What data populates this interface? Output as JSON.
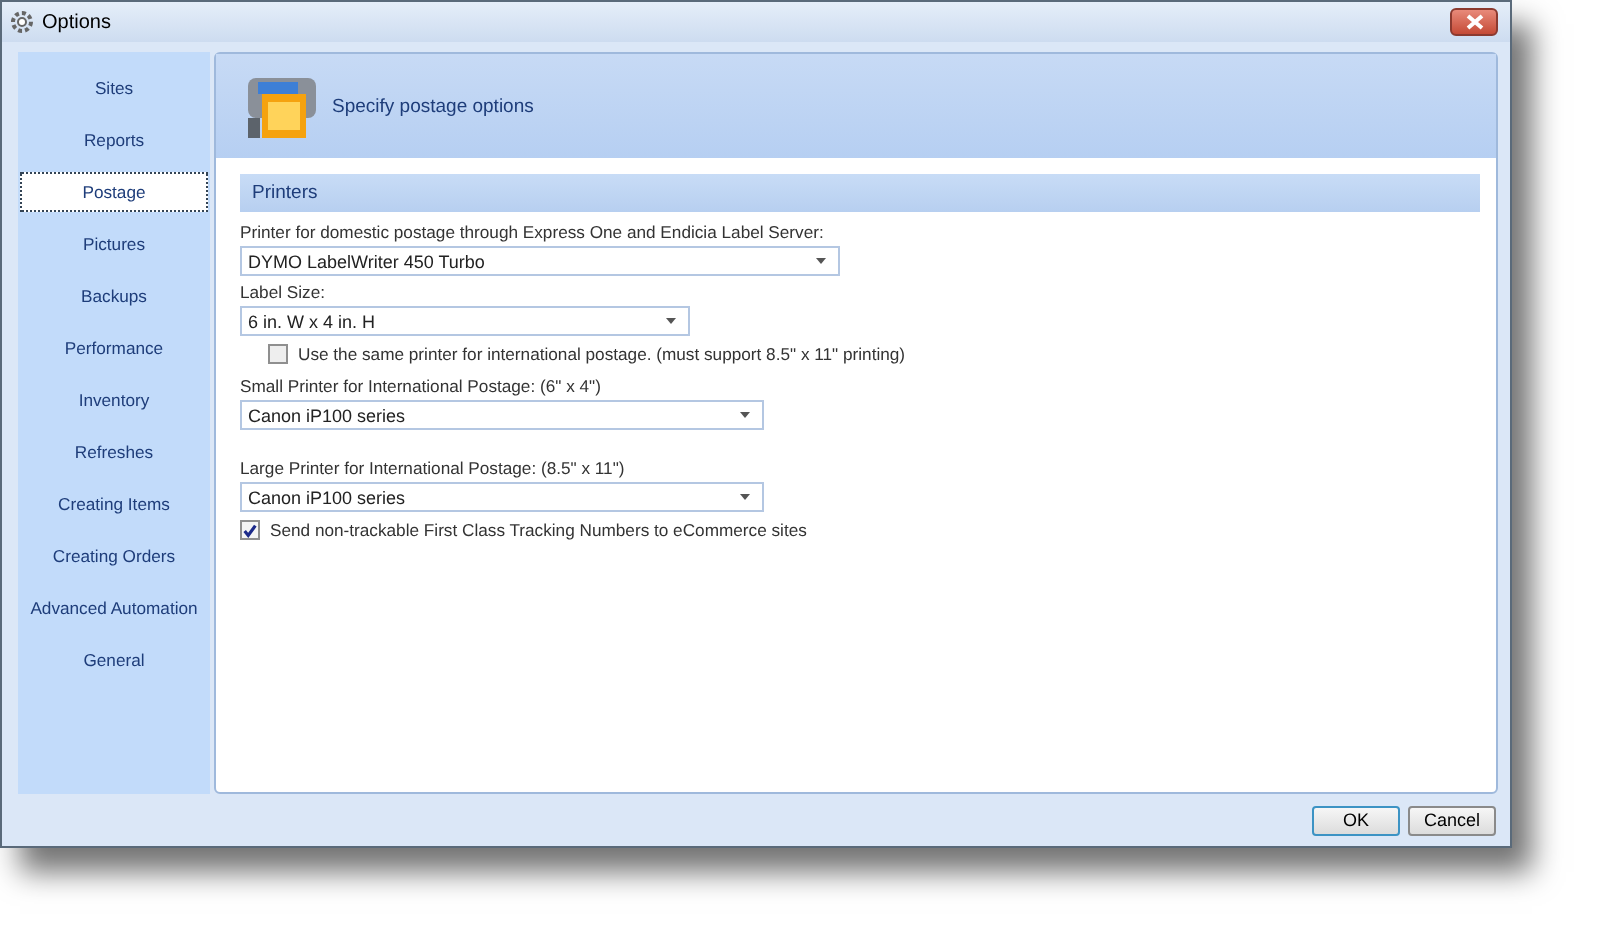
{
  "window": {
    "title": "Options"
  },
  "sidebar": {
    "items": [
      {
        "label": "Sites",
        "selected": false
      },
      {
        "label": "Reports",
        "selected": false
      },
      {
        "label": "Postage",
        "selected": true
      },
      {
        "label": "Pictures",
        "selected": false
      },
      {
        "label": "Backups",
        "selected": false
      },
      {
        "label": "Performance",
        "selected": false
      },
      {
        "label": "Inventory",
        "selected": false
      },
      {
        "label": "Refreshes",
        "selected": false
      },
      {
        "label": "Creating Items",
        "selected": false
      },
      {
        "label": "Creating Orders",
        "selected": false
      },
      {
        "label": "Advanced Automation",
        "selected": false
      },
      {
        "label": "General",
        "selected": false
      }
    ]
  },
  "header": {
    "title": "Specify postage options"
  },
  "section": {
    "title": "Printers"
  },
  "controls": [
    {
      "kind": "dropdown",
      "label": "Printer for domestic postage through Express One and Endicia Label Server:",
      "value": "DYMO LabelWriter 450 Turbo"
    },
    {
      "kind": "dropdown",
      "label": "Label Size:",
      "value": "6 in. W x 4 in. H"
    },
    {
      "kind": "checkbox",
      "label": "Use the same printer for international postage. (must support 8.5\" x 11\" printing)",
      "checked": false
    },
    {
      "kind": "dropdown",
      "label": "Small Printer for International Postage: (6\" x 4\")",
      "value": "Canon iP100 series"
    },
    {
      "kind": "dropdown",
      "label": "Large Printer for International Postage: (8.5\" x 11\")",
      "value": "Canon iP100 series"
    },
    {
      "kind": "checkbox",
      "label": "Send non-trackable First Class Tracking Numbers to eCommerce sites",
      "checked": true
    }
  ],
  "buttons": [
    "OK",
    "Cancel"
  ]
}
